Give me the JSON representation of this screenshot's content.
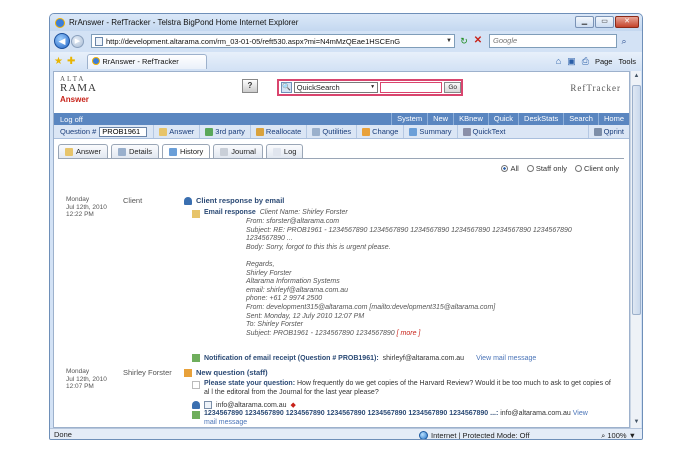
{
  "browser": {
    "title": "RrAnswer - RefTracker - Telstra BigPond Home Internet Explorer",
    "address": "http://development.altarama.com/rm_03-01-05/reft530.aspx?mi=N4mMzQEae1HSCEnG",
    "search_placeholder": "Google",
    "tab_label": "RrAnswer - RefTracker",
    "cmd_page": "Page",
    "cmd_tools": "Tools",
    "status": "Done",
    "zone": "Internet | Protected Mode: Off",
    "zoom": "100%"
  },
  "app": {
    "logo_top": "ALTA",
    "logo_main": "RAMA",
    "logo_sub": "Answer",
    "quicksearch_value": "QuickSearch",
    "go_label": "Go",
    "product": "RefTracker",
    "logoff": "Log off",
    "top_menu": [
      "System",
      "New",
      "KBnew",
      "Quick",
      "DeskStats",
      "Search",
      "Home"
    ],
    "question_label": "Question #",
    "question_value": "PROB1961",
    "actions": [
      "Answer",
      "3rd party",
      "Reallocate",
      "Qutilities",
      "Change",
      "Summary",
      "QuickText",
      "Qprint"
    ],
    "tabs": [
      "Answer",
      "Details",
      "History",
      "Journal",
      "Log"
    ],
    "active_tab": "History",
    "filters": [
      "All",
      "Staff only",
      "Client only"
    ],
    "selected_filter": "All"
  },
  "entries": [
    {
      "date_line1": "Monday",
      "date_line2": "Jul 12th, 2010",
      "time": "12:22 PM",
      "who": "Client",
      "heading": "Client response by email",
      "email_label": "Email response",
      "email_lines": [
        "Client Name: Shirley Forster",
        "From: sforster@altarama.com",
        "Subject: RE: PROB1961 - 1234567890 1234567890 1234567890 1234567890 1234567890 1234567890",
        "1234567890 ...",
        "Body: Sorry, forgot to this this is urgent please.",
        "",
        "Regards,",
        "Shirley Forster",
        "Altarama Information Systems",
        "email: shirleyf@altarama.com.au",
        "phone: +61 2 9974 2500",
        "From: development315@altarama.com [mailto:development315@altarama.com]",
        "Sent: Monday, 12 July 2010 12:07 PM",
        "To: Shirley Forster",
        "Subject: PROB1961 - 1234567890 1234567890"
      ],
      "more": "[ more ]",
      "notification_label": "Notification of email receipt (Question # PROB1961):",
      "notification_value": "shirleyf@altarama.com.au",
      "view_link": "View mail message"
    },
    {
      "date_line1": "Monday",
      "date_line2": "Jul 12th, 2010",
      "time": "12:07 PM",
      "who": "Shirley Forster",
      "heading": "New question (staff)",
      "question_label": "Please state your question:",
      "question_text_1": "How frequently do we get copies of the Harvard Review? Would it be too much to ask to get copies of",
      "question_text_2": "al l the editoral from the Journal for the last year please?",
      "contact_email": "info@altarama.com.au",
      "required_mark": "◆",
      "mail_subject": "1234567890 1234567890 1234567890 1234567890 1234567890 1234567890 1234567890 ...:",
      "mail_to": "info@altarama.com.au",
      "view_link": "View",
      "view_link_2": "mail message"
    }
  ]
}
